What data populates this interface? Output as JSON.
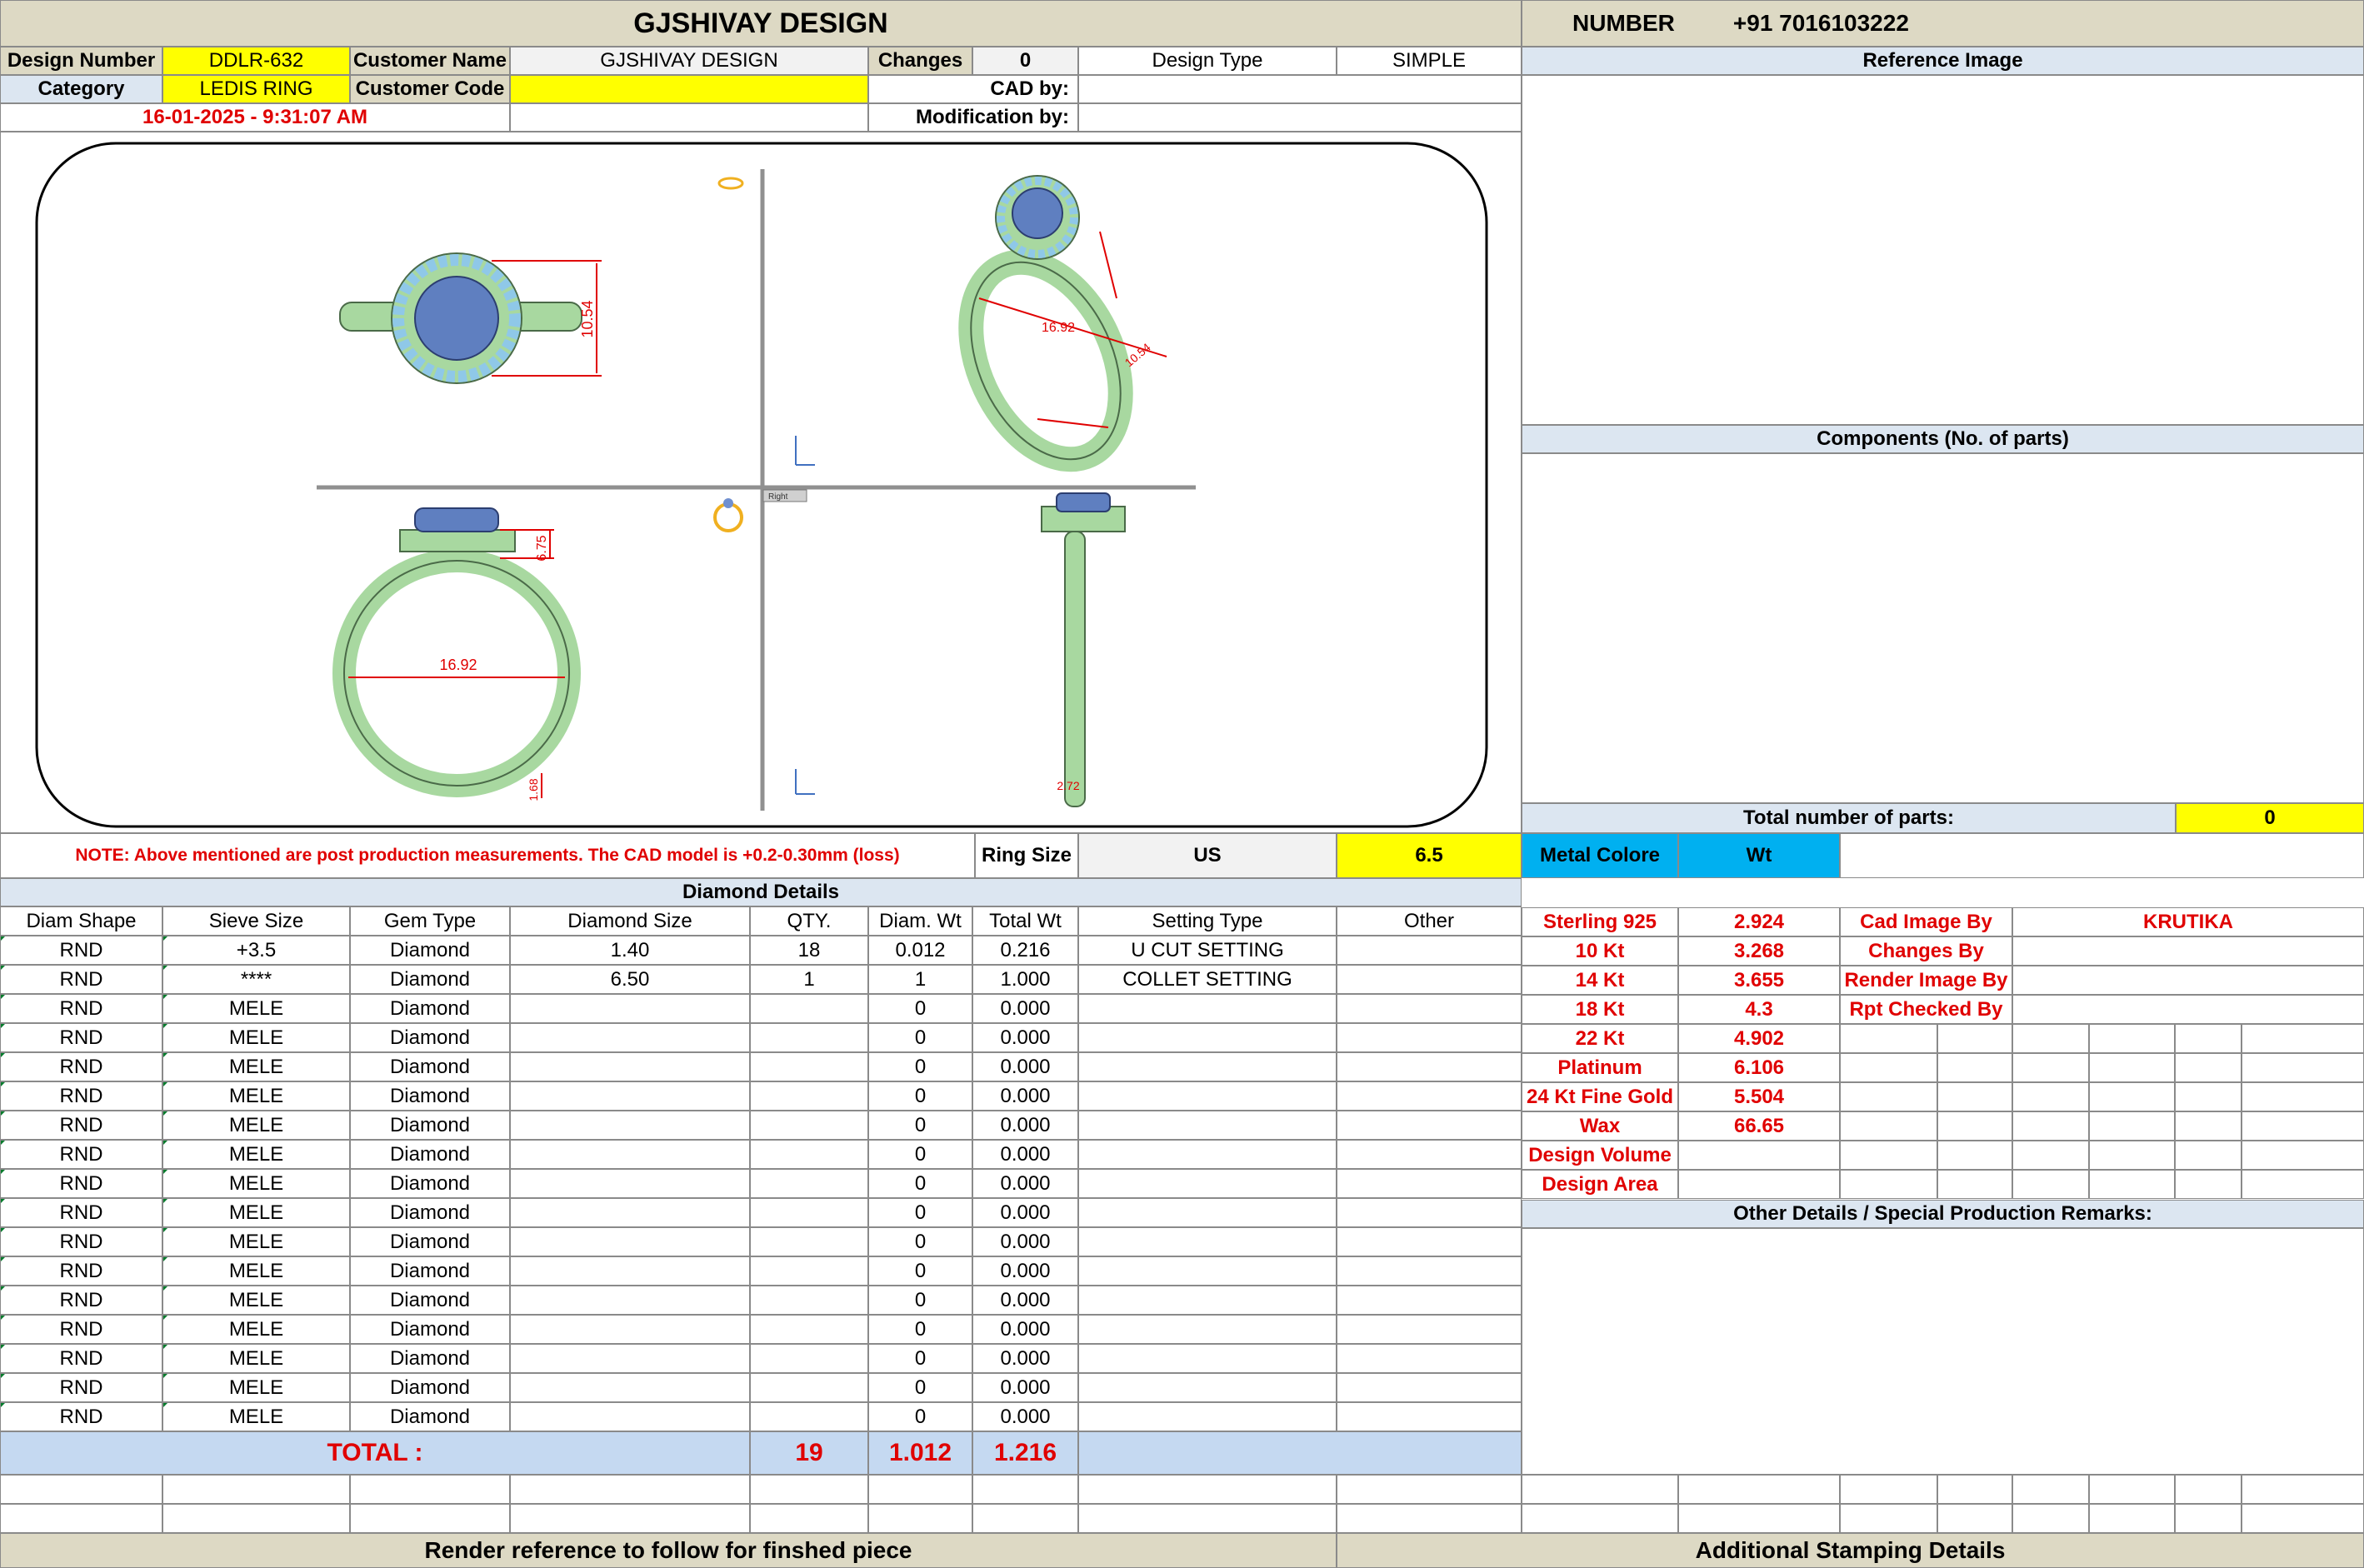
{
  "header": {
    "title": "GJSHIVAY DESIGN",
    "number_label": "NUMBER",
    "number_value": "+91 7016103222"
  },
  "info": {
    "design_number_label": "Design Number",
    "design_number": "DDLR-632",
    "customer_name_label": "Customer Name",
    "customer_name": "GJSHIVAY DESIGN",
    "changes_label": "Changes",
    "changes": "0",
    "design_type_label": "Design Type",
    "design_type": "SIMPLE",
    "category_label": "Category",
    "category": "LEDIS RING",
    "customer_code_label": "Customer Code",
    "customer_code": "",
    "cad_by_label": "CAD by:",
    "cad_by": "",
    "datetime": "16-01-2025 - 9:31:07 AM",
    "modification_by_label": "Modification by:",
    "modification_by": ""
  },
  "drawing": {
    "dim_top": "10.54",
    "dim_persp_a": "16.92",
    "dim_persp_b": "10.54",
    "dim_front_h": "6.75",
    "dim_front_w": "16.92",
    "dim_front_b": "1.68",
    "dim_side_b": "2.72",
    "view_label": "Right"
  },
  "right_panel": {
    "reference_image": "Reference Image",
    "components": "Components (No. of parts)",
    "total_parts_label": "Total number of parts:",
    "total_parts": "0"
  },
  "note": "NOTE: Above mentioned are post production measurements. The CAD model is +0.2-0.30mm (loss)",
  "ring_size": {
    "label": "Ring Size",
    "unit": "US",
    "value": "6.5"
  },
  "diamond": {
    "title": "Diamond Details",
    "headers": [
      "Diam Shape",
      "Sieve Size",
      "Gem Type",
      "Diamond Size",
      "QTY.",
      "Diam. Wt",
      "Total Wt",
      "Setting Type",
      "Other"
    ],
    "rows": [
      [
        "RND",
        "+3.5",
        "Diamond",
        "1.40",
        "18",
        "0.012",
        "0.216",
        "U CUT SETTING",
        ""
      ],
      [
        "RND",
        "****",
        "Diamond",
        "6.50",
        "1",
        "1",
        "1.000",
        "COLLET SETTING",
        ""
      ],
      [
        "RND",
        "MELE",
        "Diamond",
        "",
        "",
        "0",
        "0.000",
        "",
        ""
      ],
      [
        "RND",
        "MELE",
        "Diamond",
        "",
        "",
        "0",
        "0.000",
        "",
        ""
      ],
      [
        "RND",
        "MELE",
        "Diamond",
        "",
        "",
        "0",
        "0.000",
        "",
        ""
      ],
      [
        "RND",
        "MELE",
        "Diamond",
        "",
        "",
        "0",
        "0.000",
        "",
        ""
      ],
      [
        "RND",
        "MELE",
        "Diamond",
        "",
        "",
        "0",
        "0.000",
        "",
        ""
      ],
      [
        "RND",
        "MELE",
        "Diamond",
        "",
        "",
        "0",
        "0.000",
        "",
        ""
      ],
      [
        "RND",
        "MELE",
        "Diamond",
        "",
        "",
        "0",
        "0.000",
        "",
        ""
      ],
      [
        "RND",
        "MELE",
        "Diamond",
        "",
        "",
        "0",
        "0.000",
        "",
        ""
      ],
      [
        "RND",
        "MELE",
        "Diamond",
        "",
        "",
        "0",
        "0.000",
        "",
        ""
      ],
      [
        "RND",
        "MELE",
        "Diamond",
        "",
        "",
        "0",
        "0.000",
        "",
        ""
      ],
      [
        "RND",
        "MELE",
        "Diamond",
        "",
        "",
        "0",
        "0.000",
        "",
        ""
      ],
      [
        "RND",
        "MELE",
        "Diamond",
        "",
        "",
        "0",
        "0.000",
        "",
        ""
      ],
      [
        "RND",
        "MELE",
        "Diamond",
        "",
        "",
        "0",
        "0.000",
        "",
        ""
      ],
      [
        "RND",
        "MELE",
        "Diamond",
        "",
        "",
        "0",
        "0.000",
        "",
        ""
      ],
      [
        "RND",
        "MELE",
        "Diamond",
        "",
        "",
        "0",
        "0.000",
        "",
        ""
      ]
    ],
    "total_label": "TOTAL :",
    "total_qty": "19",
    "total_diam_wt": "1.012",
    "total_wt": "1.216"
  },
  "metal": {
    "header_label": "Metal Colore",
    "header_wt": "Wt",
    "rows": [
      [
        "Sterling 925",
        "2.924"
      ],
      [
        "10 Kt",
        "3.268"
      ],
      [
        "14 Kt",
        "3.655"
      ],
      [
        "18 Kt",
        "4.3"
      ],
      [
        "22 Kt",
        "4.902"
      ],
      [
        "Platinum",
        "6.106"
      ],
      [
        "24 Kt Fine Gold",
        "5.504"
      ],
      [
        "Wax",
        "66.65"
      ],
      [
        "Design Volume",
        ""
      ],
      [
        "Design Area",
        ""
      ]
    ]
  },
  "credits": [
    [
      "Cad Image By",
      "KRUTIKA"
    ],
    [
      "Changes By",
      ""
    ],
    [
      "Render Image By",
      ""
    ],
    [
      "Rpt Checked By",
      ""
    ]
  ],
  "other_details": "Other Details / Special Production Remarks:",
  "footer": {
    "render_ref": "Render reference to follow for finshed piece",
    "stamping": "Additional Stamping Details"
  },
  "colors": {
    "ring_metal": "#a8d8a0",
    "ring_stone": "#5f7fc0",
    "halo": "#8fc8e8",
    "dimension": "#e00000"
  }
}
